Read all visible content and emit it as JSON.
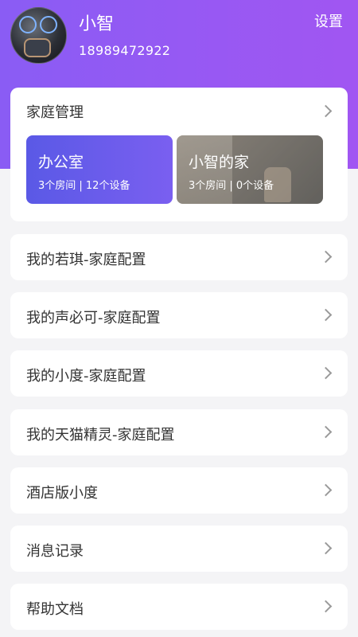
{
  "header": {
    "user_name": "小智",
    "phone": "18989472922",
    "settings_label": "设置"
  },
  "family": {
    "title": "家庭管理",
    "homes": [
      {
        "name": "办公室",
        "meta": "3个房间 | 12个设备"
      },
      {
        "name": "小智的家",
        "meta": "3个房间 | 0个设备"
      }
    ]
  },
  "menu": [
    {
      "label": "我的若琪-家庭配置"
    },
    {
      "label": "我的声必可-家庭配置"
    },
    {
      "label": "我的小度-家庭配置"
    },
    {
      "label": "我的天猫精灵-家庭配置"
    },
    {
      "label": "酒店版小度"
    },
    {
      "label": "消息记录"
    },
    {
      "label": "帮助文档"
    }
  ],
  "colors": {
    "header_gradient_start": "#8a5cf4",
    "header_gradient_end": "#a156f2",
    "office_tile": "#5a59e6"
  }
}
